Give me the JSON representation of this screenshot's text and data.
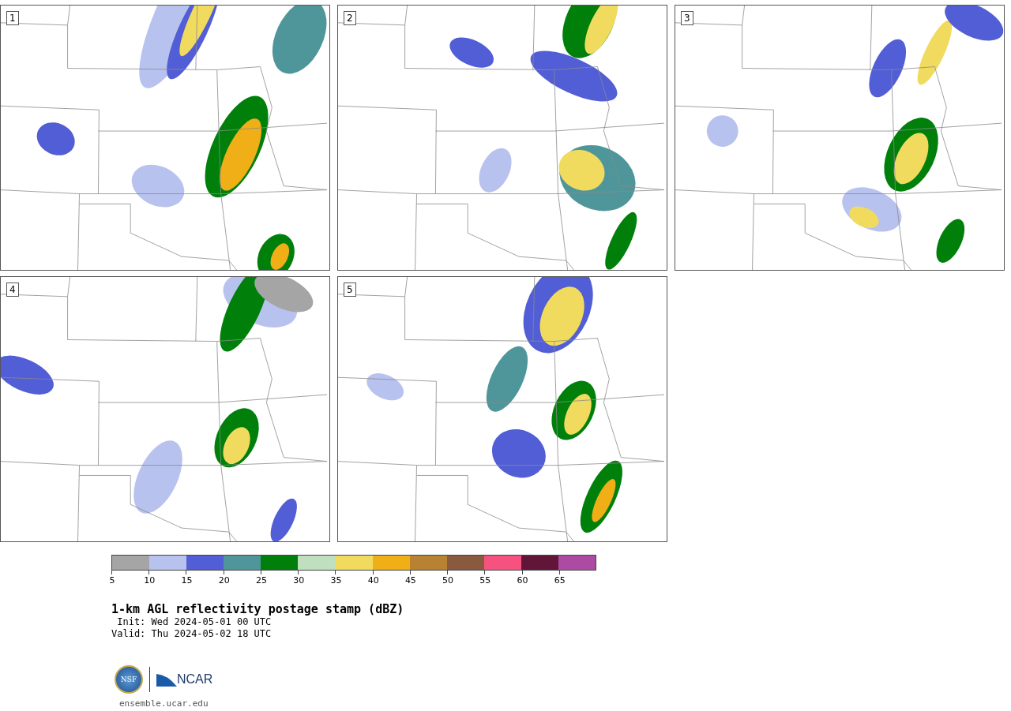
{
  "panels": [
    {
      "number": "1"
    },
    {
      "number": "2"
    },
    {
      "number": "3"
    },
    {
      "number": "4"
    },
    {
      "number": "5"
    }
  ],
  "colorbar": {
    "bins": [
      {
        "label": "5",
        "color": "#a5a5a5"
      },
      {
        "label": "10",
        "color": "#b8c2ee"
      },
      {
        "label": "15",
        "color": "#525ed6"
      },
      {
        "label": "20",
        "color": "#4f969b"
      },
      {
        "label": "25",
        "color": "#00800a"
      },
      {
        "label": "30",
        "color": "#bfdfbf"
      },
      {
        "label": "35",
        "color": "#f1db5f"
      },
      {
        "label": "40",
        "color": "#f0ae17"
      },
      {
        "label": "45",
        "color": "#b98232"
      },
      {
        "label": "50",
        "color": "#8a5a3f"
      },
      {
        "label": "55",
        "color": "#f5527f"
      },
      {
        "label": "60",
        "color": "#611538"
      },
      {
        "label": "65",
        "color": "#ad4aa3"
      }
    ]
  },
  "title": "1-km AGL reflectivity postage stamp (dBZ)",
  "init": " Init: Wed 2024-05-01 00 UTC",
  "valid": "Valid: Thu 2024-05-02 18 UTC",
  "logos": {
    "nsf": "NSF",
    "ncar": "NCAR"
  },
  "site": "ensemble.ucar.edu"
}
